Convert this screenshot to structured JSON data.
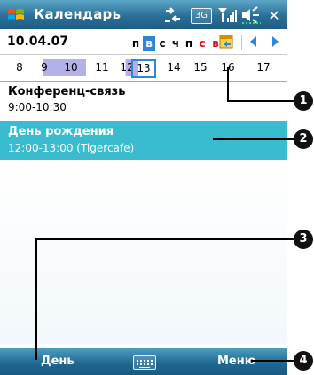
{
  "titlebar": {
    "title": "Календарь",
    "network_badge": "3G",
    "close": "✕"
  },
  "dateheader": {
    "current_date": "10.04.07",
    "weekdays": [
      "п",
      "в",
      "с",
      "ч",
      "п",
      "с",
      "в"
    ],
    "selected_weekday_index": 1
  },
  "daystrip": {
    "days": [
      "8",
      "9",
      "10",
      "11",
      "12",
      "13",
      "14",
      "15",
      "16",
      "17"
    ]
  },
  "appointments": [
    {
      "title": "Конференц-связь",
      "time": "9:00-10:30"
    },
    {
      "title": "День рождения",
      "time": "12:00-13:00 (Tigercafe)"
    }
  ],
  "menubar": {
    "left_softkey": "День",
    "right_softkey": "Меню"
  },
  "callouts": [
    "1",
    "2",
    "3",
    "4"
  ],
  "colors": {
    "titlebar": "#2a6f97",
    "selection": "#39bcd0",
    "weekday_selected": "#2f86d9",
    "highlight_days": "#b3b1e8",
    "weekend": "#d8141b"
  }
}
